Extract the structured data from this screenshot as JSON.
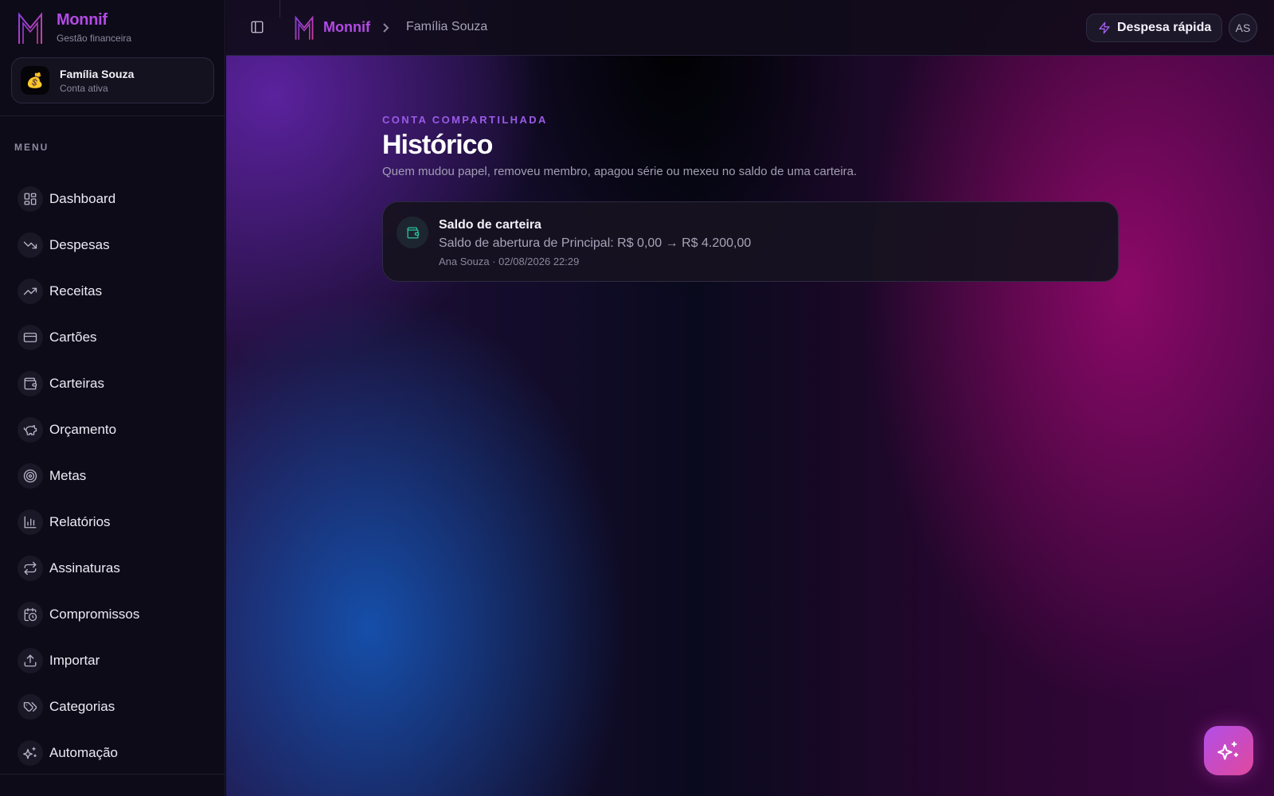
{
  "brand": {
    "name": "Monnif",
    "subtitle": "Gestão financeira"
  },
  "account": {
    "name": "Família Souza",
    "status": "Conta ativa",
    "avatar": "💰"
  },
  "sidebar": {
    "menu_heading": "MENU",
    "items": [
      {
        "label": "Dashboard",
        "icon": "dashboard-icon"
      },
      {
        "label": "Despesas",
        "icon": "trending-down-icon"
      },
      {
        "label": "Receitas",
        "icon": "trending-up-icon"
      },
      {
        "label": "Cartões",
        "icon": "credit-card-icon"
      },
      {
        "label": "Carteiras",
        "icon": "wallet-icon"
      },
      {
        "label": "Orçamento",
        "icon": "piggy-bank-icon"
      },
      {
        "label": "Metas",
        "icon": "target-icon"
      },
      {
        "label": "Relatórios",
        "icon": "bar-chart-icon"
      },
      {
        "label": "Assinaturas",
        "icon": "repeat-icon"
      },
      {
        "label": "Compromissos",
        "icon": "calendar-clock-icon"
      },
      {
        "label": "Importar",
        "icon": "upload-icon"
      },
      {
        "label": "Categorias",
        "icon": "tags-icon"
      },
      {
        "label": "Automação",
        "icon": "sparkles-icon"
      }
    ]
  },
  "header": {
    "breadcrumb_brand": "Monnif",
    "breadcrumb_current": "Família Souza",
    "quick_expense_label": "Despesa rápida",
    "user_initials": "AS"
  },
  "page": {
    "eyebrow": "CONTA COMPARTILHADA",
    "title": "Histórico",
    "description": "Quem mudou papel, removeu membro, apagou série ou mexeu no saldo de uma carteira."
  },
  "log": [
    {
      "title": "Saldo de carteira",
      "detail": "Saldo de abertura de Principal: R$ 0,00 → R$ 4.200,00",
      "meta": "Ana Souza · 02/08/2026 22:29",
      "icon": "wallet-icon"
    }
  ],
  "colors": {
    "accent": "#b44ae6",
    "wallet_icon": "#2ec4a0",
    "fab_start": "#b24ee8",
    "fab_end": "#e0489c"
  }
}
